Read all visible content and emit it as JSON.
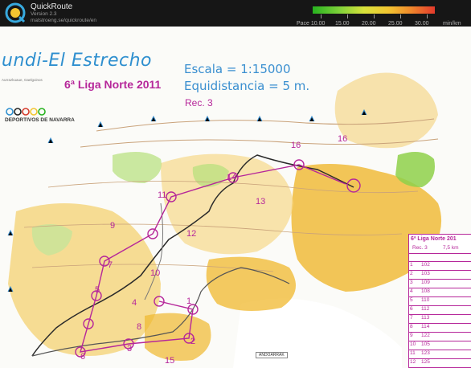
{
  "app": {
    "name": "QuickRoute",
    "version": "Version 2.3",
    "url": "matstroeng.se/quickroute/en"
  },
  "pace_legend": {
    "labels": [
      "Pace 10.00",
      "15.00",
      "20.00",
      "25.00",
      "30.00",
      "min/km"
    ]
  },
  "map": {
    "title": "undi-El Estrecho",
    "scale": "Escala = 1:15000",
    "equidistance": "Equidistancia = 5 m.",
    "event": "6ª Liga Norte 2011",
    "course": "Rec. 3",
    "organizer": "DEPORTIVOS DE NAVARRA",
    "small_text": "Aurrazkuaue, Gaelgoinos",
    "controls": [
      "1",
      "2",
      "3",
      "4",
      "5",
      "6",
      "7",
      "8",
      "9",
      "10",
      "11",
      "12",
      "13",
      "14",
      "15",
      "16",
      "16"
    ],
    "description": {
      "title": "6ª Liga Norte 201",
      "course": "Rec. 3",
      "distance": "7,5 km",
      "rows": [
        {
          "num": "1",
          "code": "102"
        },
        {
          "num": "2",
          "code": "103"
        },
        {
          "num": "3",
          "code": "109"
        },
        {
          "num": "4",
          "code": "108"
        },
        {
          "num": "5",
          "code": "110"
        },
        {
          "num": "6",
          "code": "112"
        },
        {
          "num": "7",
          "code": "113"
        },
        {
          "num": "8",
          "code": "114"
        },
        {
          "num": "9",
          "code": "122"
        },
        {
          "num": "10",
          "code": "105"
        },
        {
          "num": "11",
          "code": "123"
        },
        {
          "num": "12",
          "code": "125"
        },
        {
          "num": "13",
          "code": "133"
        }
      ]
    },
    "legend_box": "ANDOARRAK"
  },
  "colors": {
    "topbar": "#161616",
    "route": "#2a2a2a",
    "course": "#b6279a",
    "terrain_yellow": "#f0b82e",
    "vegetation_green": "#8ed04a",
    "map_blue": "#2e8fcf"
  }
}
